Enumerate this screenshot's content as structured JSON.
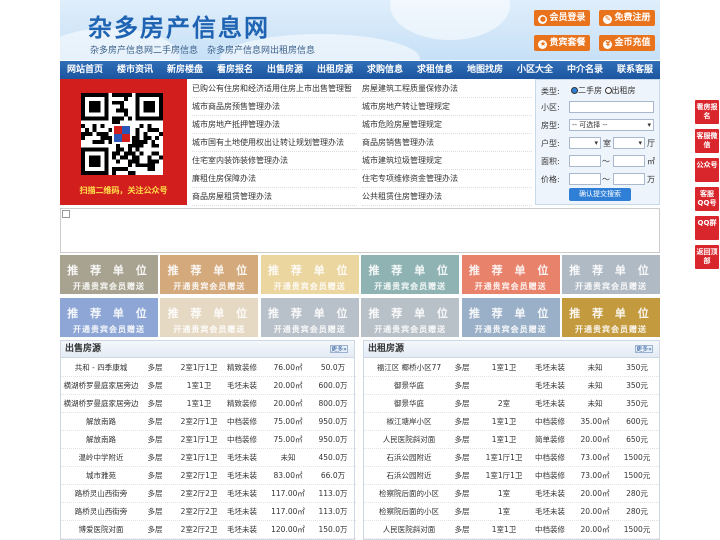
{
  "header": {
    "site_title": "杂多房产信息网",
    "tagline": "杂多房产信息网二手房信息　杂多房产信息网出租房信息",
    "buttons": [
      {
        "label": "会员登录"
      },
      {
        "label": "免费注册"
      },
      {
        "label": "贵宾套餐"
      },
      {
        "label": "金币充值"
      }
    ]
  },
  "nav": [
    "网站首页",
    "楼市资讯",
    "新房楼盘",
    "看房报名",
    "出售房源",
    "出租房源",
    "求购信息",
    "求租信息",
    "地图找房",
    "小区大全",
    "中介名录",
    "联系客服"
  ],
  "qr": {
    "caption": "扫描二维码，关注公众号"
  },
  "links": [
    [
      "已购公有住房和经济适用住房上市出售管理暂",
      "房屋建筑工程质量保修办法"
    ],
    [
      "城市商品房预售管理办法",
      "城市房地产转让管理规定"
    ],
    [
      "城市房地产抵押管理办法",
      "城市危险房屋管理规定"
    ],
    [
      "城市国有土地使用权出让转让规划管理办法",
      "商品房销售管理办法"
    ],
    [
      "住宅室内装饰装修管理办法",
      "城市建筑垃圾管理规定"
    ],
    [
      "廉租住房保障办法",
      "住宅专项维修资金管理办法"
    ],
    [
      "商品房屋租赁管理办法",
      "公共租赁住房管理办法"
    ]
  ],
  "search": {
    "type_label": "类型:",
    "type_opt1": "二手房",
    "type_opt2": "出租房",
    "district_label": "小区:",
    "house_label": "房型:",
    "house_select": "-- 可选择 --",
    "layout_label": "户型:",
    "room_unit": "室",
    "hall_unit": "厅",
    "area_label": "面积:",
    "area_unit": "㎡",
    "price_label": "价格:",
    "price_unit": "万",
    "tilde": "～",
    "submit": "确认提交搜索"
  },
  "ads": {
    "title": "推 荐 单 位",
    "sub": "开通贵宾会员赠送"
  },
  "sale": {
    "title": "出售房源",
    "more": "更多»",
    "rows": [
      [
        "共和 - 四季康城",
        "多层",
        "2室1厅1卫",
        "精致装修",
        "76.00㎡",
        "50.0万"
      ],
      [
        "横湖桥罗曼庭家居旁边",
        "多层",
        "1室1卫",
        "毛坯未装",
        "20.00㎡",
        "600.0万"
      ],
      [
        "横湖桥罗曼庭家居旁边",
        "多层",
        "1室1卫",
        "精致装修",
        "20.00㎡",
        "800.0万"
      ],
      [
        "解放南路",
        "多层",
        "2室2厅1卫",
        "中档装修",
        "75.00㎡",
        "950.0万"
      ],
      [
        "解放南路",
        "多层",
        "2室1厅1卫",
        "中档装修",
        "75.00㎡",
        "950.0万"
      ],
      [
        "温岭中学附近",
        "多层",
        "2室1厅1卫",
        "毛坯未装",
        "未知",
        "450.0万"
      ],
      [
        "城市雅苑",
        "多层",
        "2室2厅1卫",
        "毛坯未装",
        "83.00㎡",
        "66.0万"
      ],
      [
        "路桥灵山西街旁",
        "多层",
        "2室2厅2卫",
        "毛坯未装",
        "117.00㎡",
        "113.0万"
      ],
      [
        "路桥灵山西街旁",
        "多层",
        "2室2厅2卫",
        "毛坯未装",
        "117.00㎡",
        "113.0万"
      ],
      [
        "博爱医院对面",
        "多层",
        "2室2厅2卫",
        "毛坯未装",
        "120.00㎡",
        "150.0万"
      ]
    ]
  },
  "rent": {
    "title": "出租房源",
    "more": "更多»",
    "rows": [
      [
        "福江区 椰桥小区77",
        "多层",
        "1室1卫",
        "毛坯未装",
        "未知",
        "350元"
      ],
      [
        "御景华庭",
        "多层",
        "",
        "毛坯未装",
        "未知",
        "350元"
      ],
      [
        "御景华庭",
        "多层",
        "2室",
        "毛坯未装",
        "未知",
        "350元"
      ],
      [
        "椒江塘岸小区",
        "多层",
        "1室1卫",
        "中档装修",
        "35.00㎡",
        "600元"
      ],
      [
        "人民医院斜对面",
        "多层",
        "1室1卫",
        "简单装修",
        "20.00㎡",
        "650元"
      ],
      [
        "石浜公园附近",
        "多层",
        "1室1厅1卫",
        "中档装修",
        "73.00㎡",
        "1500元"
      ],
      [
        "石浜公园附近",
        "多层",
        "1室1厅1卫",
        "中档装修",
        "73.00㎡",
        "1500元"
      ],
      [
        "检察院后面的小区",
        "多层",
        "1室",
        "毛坯未装",
        "20.00㎡",
        "280元"
      ],
      [
        "检察院后面的小区",
        "多层",
        "1室",
        "毛坯未装",
        "20.00㎡",
        "280元"
      ],
      [
        "人民医院斜对面",
        "多层",
        "1室1卫",
        "中档装修",
        "20.00㎡",
        "1500元"
      ]
    ]
  },
  "side": [
    "看房报名",
    "客服微信",
    "公众号",
    "客服QQ号",
    "QQ群",
    "返回顶部"
  ],
  "colors": {
    "nav": "#1f5ca6",
    "accent": "#e9731c",
    "qr_bg": "#d31e1e",
    "side": "#d9262c"
  }
}
